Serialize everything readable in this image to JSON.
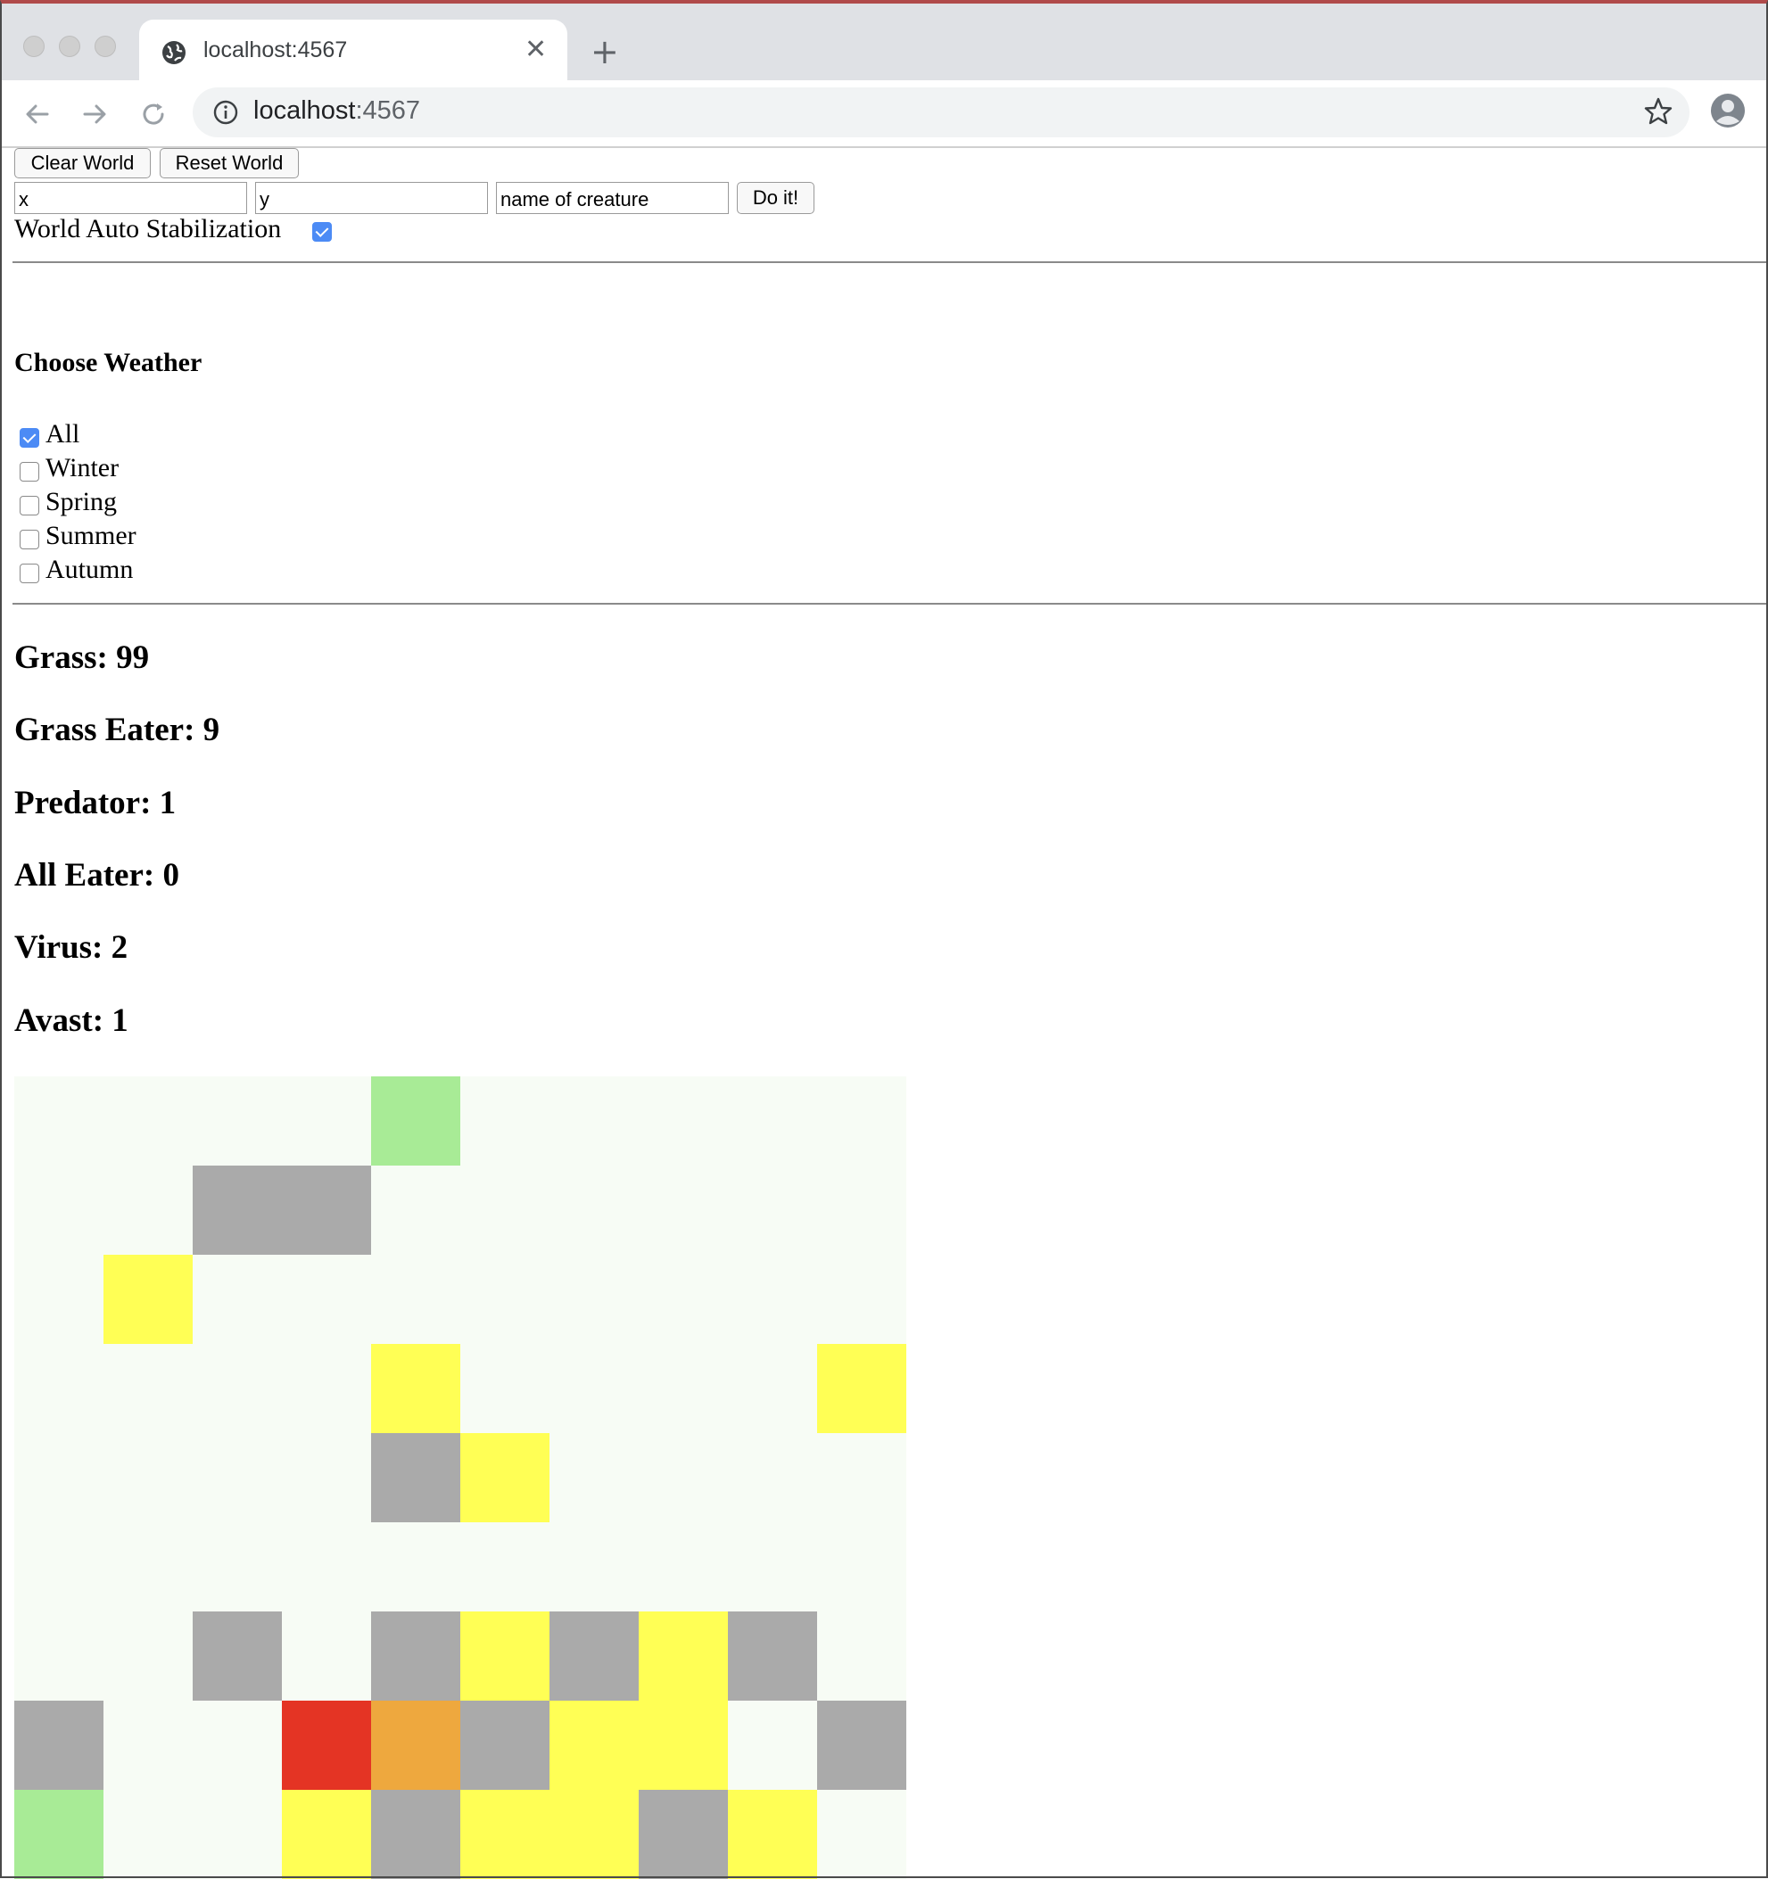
{
  "browser": {
    "tab_title": "localhost:4567",
    "new_tab_label": "+",
    "url_host": "localhost",
    "url_port": ":4567"
  },
  "controls": {
    "clear_label": "Clear World",
    "reset_label": "Reset World",
    "x_value": "x",
    "y_value": "y",
    "creature_value": "name of creature",
    "do_label": "Do it!",
    "stabilization_label": "World Auto Stabilization",
    "stabilization_checked": true
  },
  "weather": {
    "heading": "Choose Weather",
    "options": [
      {
        "label": "All",
        "checked": true
      },
      {
        "label": "Winter",
        "checked": false
      },
      {
        "label": "Spring",
        "checked": false
      },
      {
        "label": "Summer",
        "checked": false
      },
      {
        "label": "Autumn",
        "checked": false
      }
    ]
  },
  "stats": [
    {
      "text": "Grass: 99"
    },
    {
      "text": "Grass Eater: 9"
    },
    {
      "text": "Predator: 1"
    },
    {
      "text": "All Eater: 0"
    },
    {
      "text": "Virus: 2"
    },
    {
      "text": "Avast: 1"
    }
  ],
  "colors": {
    "empty": "#f7fcf5",
    "G": "#a8eb96",
    "E": "#aaaaaa",
    "Y": "#ffff55",
    "R": "#e43424",
    "O": "#eea83e",
    "checkbox_on": "#4c8bf5"
  },
  "world": {
    "rows": [
      "....G.....",
      "..EE......",
      ".Y........",
      "....Y....Y",
      "....EY....",
      "..........",
      "..E.EYEYE.",
      "E..ROEYY.E",
      "G..YEYYEY.",
      "..........",
      ".........."
    ]
  }
}
